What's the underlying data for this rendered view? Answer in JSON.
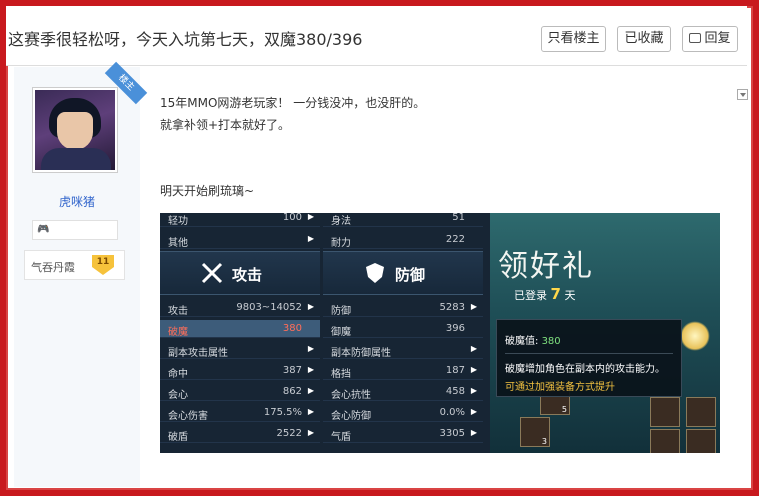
{
  "thread": {
    "title": "这赛季很轻松呀，今天入坑第七天，双魔380/396",
    "buttons": {
      "only_op": "只看楼主",
      "favorited": "已收藏",
      "reply": "回复"
    }
  },
  "author": {
    "op_badge": "楼主",
    "username": "虎咪猪",
    "title_label": "气吞丹霞",
    "level": "11"
  },
  "post": {
    "lines": [
      "15年MMO网游老玩家！ 一分钱没冲，也没肝的。",
      "就拿补领+打本就好了。",
      "明天开始刷琉璃~"
    ]
  },
  "game_screenshot": {
    "top_rows": [
      {
        "label": "轻功",
        "value": "100"
      },
      {
        "label": "身法",
        "value": "51"
      },
      {
        "label": "其他",
        "value": ""
      },
      {
        "label": "耐力",
        "value": "222"
      }
    ],
    "sections": {
      "attack": "攻击",
      "defense": "防御"
    },
    "attack_rows": [
      {
        "label": "攻击",
        "value": "9803~14052"
      },
      {
        "label": "破魔",
        "value": "380"
      },
      {
        "label": "副本攻击属性",
        "value": ""
      },
      {
        "label": "命中",
        "value": "387"
      },
      {
        "label": "会心",
        "value": "862"
      },
      {
        "label": "会心伤害",
        "value": "175.5%"
      },
      {
        "label": "破盾",
        "value": "2522"
      }
    ],
    "defense_rows": [
      {
        "label": "防御",
        "value": "5283"
      },
      {
        "label": "御魔",
        "value": "396"
      },
      {
        "label": "副本防御属性",
        "value": ""
      },
      {
        "label": "格挡",
        "value": "187"
      },
      {
        "label": "会心抗性",
        "value": "458"
      },
      {
        "label": "会心防御",
        "value": "0.0%"
      },
      {
        "label": "气盾",
        "value": "3305"
      }
    ],
    "gift": {
      "title": "领好礼",
      "logged_prefix": "已登录",
      "days": "7",
      "days_suffix": "天",
      "slot_count_a": "5",
      "slot_count_b": "3"
    },
    "tooltip": {
      "label": "破魔值:",
      "value": "380",
      "desc": "破魔增加角色在副本内的攻击能力。",
      "hint": "可通过加强装备方式提升"
    },
    "colors": {
      "highlight": "#ff6e5a",
      "gold": "#ffd84a",
      "green": "#7ee07e"
    }
  }
}
